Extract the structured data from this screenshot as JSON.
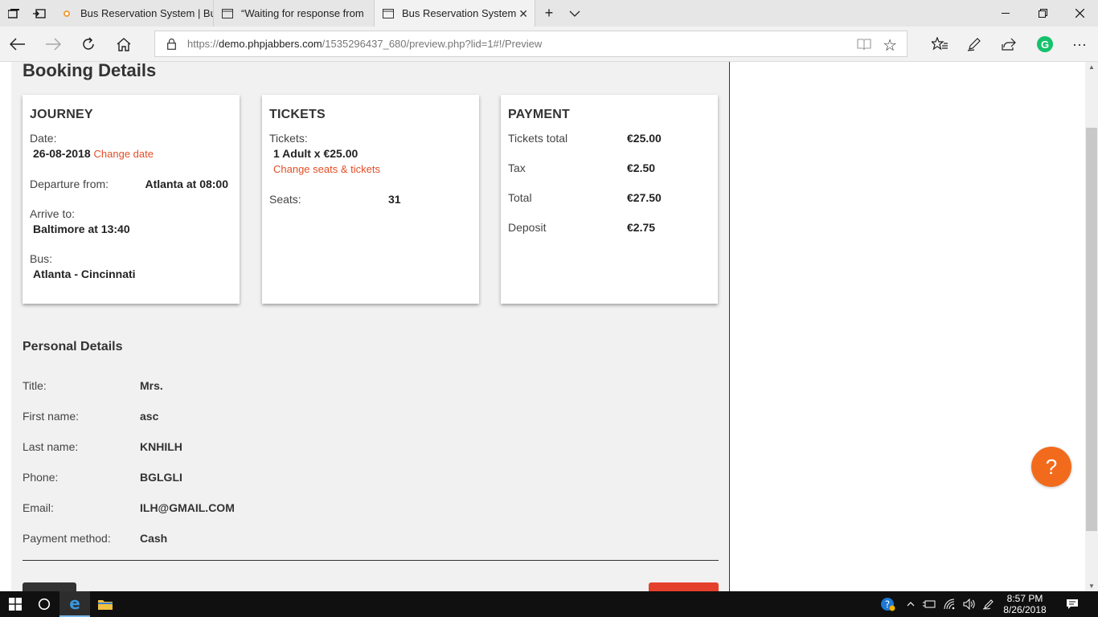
{
  "browser": {
    "tabs": [
      {
        "title": "Bus Reservation System | Bu"
      },
      {
        "title": "“Waiting for response from"
      },
      {
        "title": "Bus Reservation System"
      }
    ],
    "url_host": "demo.phpjabbers.com",
    "url_prefix": "https://",
    "url_path": "/1535296437_680/preview.php?lid=1#!/Preview"
  },
  "page": {
    "title": "Booking Details",
    "journey": {
      "heading": "JOURNEY",
      "date_label": "Date:",
      "date_value": "26-08-2018",
      "change_date": "Change date",
      "departure_label": "Departure from:",
      "departure_value": "Atlanta at 08:00",
      "arrive_label": "Arrive to:",
      "arrive_value": "Baltimore at 13:40",
      "bus_label": "Bus:",
      "bus_value": "Atlanta - Cincinnati"
    },
    "tickets": {
      "heading": "TICKETS",
      "tickets_label": "Tickets:",
      "tickets_value": "1 Adult x €25.00",
      "change_link": "Change seats & tickets",
      "seats_label": "Seats:",
      "seats_value": "31"
    },
    "payment": {
      "heading": "PAYMENT",
      "rows": [
        {
          "label": "Tickets total",
          "value": "€25.00"
        },
        {
          "label": "Tax",
          "value": "€2.50"
        },
        {
          "label": "Total",
          "value": "€27.50"
        },
        {
          "label": "Deposit",
          "value": "€2.75"
        }
      ]
    },
    "personal": {
      "heading": "Personal Details",
      "rows": [
        {
          "label": "Title:",
          "value": "Mrs."
        },
        {
          "label": "First name:",
          "value": "asc"
        },
        {
          "label": "Last name:",
          "value": "KNHILH"
        },
        {
          "label": "Phone:",
          "value": "BGLGLI"
        },
        {
          "label": "Email:",
          "value": "ILH@GMAIL.COM"
        },
        {
          "label": "Payment method:",
          "value": "Cash"
        }
      ]
    },
    "help_label": "?"
  },
  "taskbar": {
    "time": "8:57 PM",
    "date": "8/26/2018"
  },
  "colors": {
    "accent": "#e44d26",
    "help": "#f26b1d",
    "confirm_button": "#e4412d"
  }
}
